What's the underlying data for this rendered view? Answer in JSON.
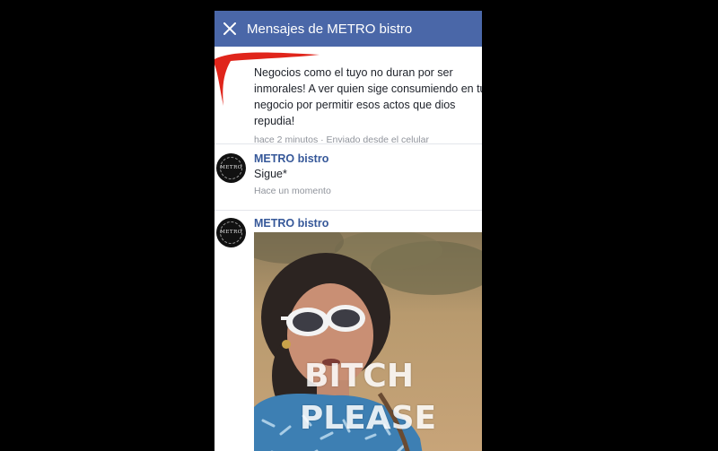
{
  "header": {
    "title": "Mensajes de METRO bistro",
    "bg_color": "#4a67a8",
    "close_icon": "close-icon"
  },
  "messages": [
    {
      "lines": [
        "Negocios como el tuyo no duran por ser",
        "inmorales! A ver quien sige consumiendo en tu",
        "negocio por permitir esos actos que dios",
        "repudia!"
      ],
      "meta": "hace 2 minutos · Enviado desde el celular",
      "redacted_name_color": "#e0251b"
    },
    {
      "sender": "METRO bistro",
      "text": "Sigue*",
      "meta": "Hace un momento"
    },
    {
      "sender": "METRO bistro",
      "gif_caption_line1": "BITCH",
      "gif_caption_line2": "PLEASE"
    }
  ],
  "avatar": {
    "logo_text": "METRO"
  }
}
